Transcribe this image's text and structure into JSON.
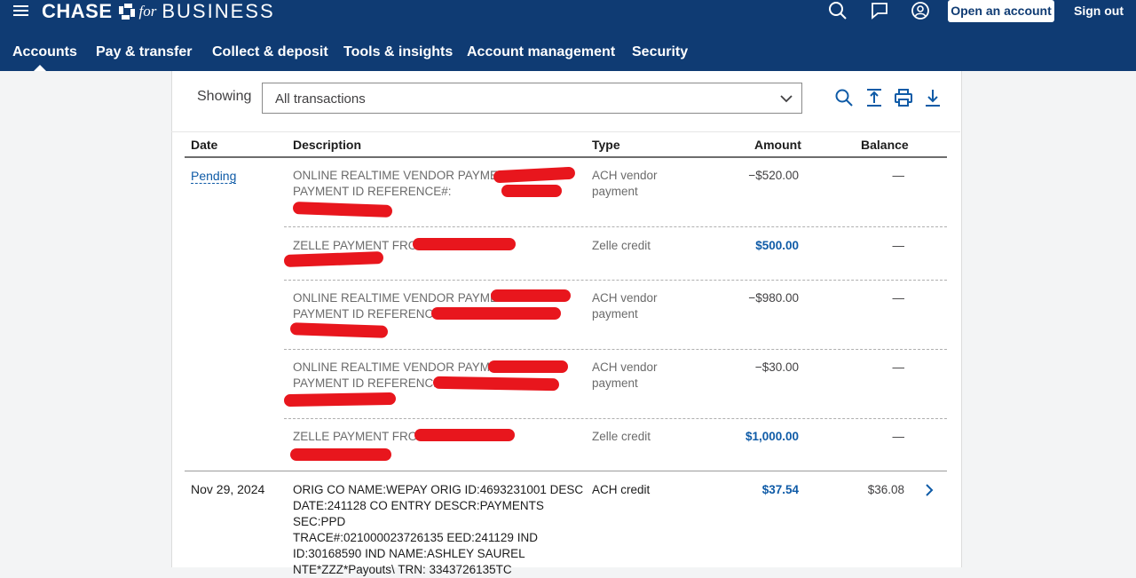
{
  "app": {
    "brand": {
      "main": "CHASE",
      "for": "for",
      "business": "BUSINESS"
    },
    "open_account_label": "Open an account",
    "sign_out_label": "Sign out",
    "nav": [
      {
        "label": "Accounts",
        "active": true
      },
      {
        "label": "Pay & transfer"
      },
      {
        "label": "Collect & deposit"
      },
      {
        "label": "Tools & insights"
      },
      {
        "label": "Account management"
      },
      {
        "label": "Security"
      }
    ],
    "icons": [
      "menu-icon",
      "search-icon",
      "messages-icon",
      "profile-icon"
    ]
  },
  "filter": {
    "label": "Showing",
    "selected": "All transactions",
    "tools": [
      "search-icon",
      "upload-icon",
      "print-icon",
      "download-icon"
    ]
  },
  "table": {
    "headers": {
      "date": "Date",
      "description": "Description",
      "type": "Type",
      "amount": "Amount",
      "balance": "Balance"
    },
    "pending_label": "Pending",
    "rows": [
      {
        "desc": "ONLINE REALTIME VENDOR PAYMENT\nPAYMENT ID REFERENCE#:",
        "type": "ACH vendor\npayment",
        "amount": "−$520.00",
        "balance": "—"
      },
      {
        "desc": "ZELLE PAYMENT FROM",
        "type": "Zelle credit",
        "amount": "$500.00",
        "balance": "—"
      },
      {
        "desc": "ONLINE REALTIME VENDOR PAYMENT\nPAYMENT ID REFERENCE#:",
        "type": "ACH vendor\npayment",
        "amount": "−$980.00",
        "balance": "—"
      },
      {
        "desc": "ONLINE REALTIME VENDOR PAYMENT\nPAYMENT ID REFERENCE#:",
        "type": "ACH vendor\npayment",
        "amount": "−$30.00",
        "balance": "—"
      },
      {
        "desc": "ZELLE PAYMENT FROM",
        "type": "Zelle credit",
        "amount": "$1,000.00",
        "balance": "—"
      },
      {
        "date": "Nov 29, 2024",
        "desc": "ORIG CO NAME:WEPAY ORIG ID:4693231001 DESC\nDATE:241128 CO ENTRY DESCR:PAYMENTS SEC:PPD\nTRACE#:021000023726135 EED:241129 IND\nID:30168590 IND NAME:ASHLEY SAUREL\nNTE*ZZZ*Payouts\\ TRN: 3343726135TC",
        "type": "ACH credit",
        "amount": "$37.54",
        "balance": "$36.08"
      }
    ]
  },
  "colors": {
    "header_bg": "#0f3b73",
    "credit": "#0f5ba7",
    "redaction": "#e8161d"
  }
}
